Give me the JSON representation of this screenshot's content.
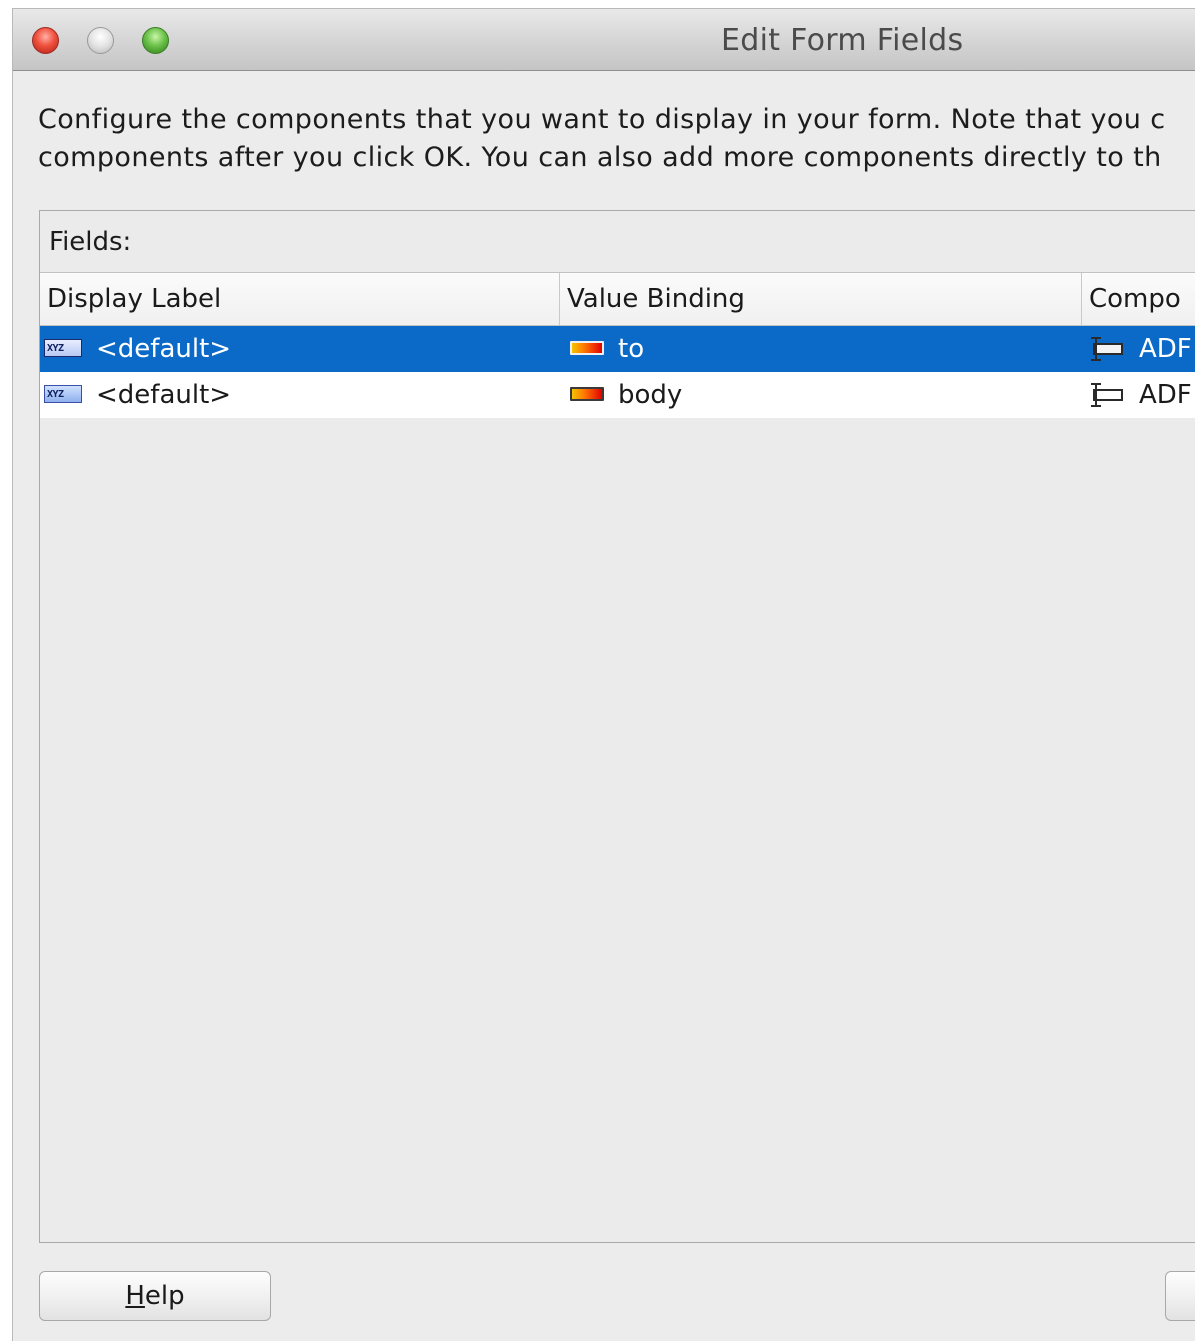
{
  "window": {
    "title": "Edit Form Fields"
  },
  "description": {
    "line1": "Configure the components that you want to display in your form.  Note that you c",
    "line2": "components after you click OK.  You can also add more components directly to th"
  },
  "fields_panel": {
    "label": "Fields:",
    "columns": [
      "Display Label",
      "Value Binding",
      "Compo"
    ],
    "rows": [
      {
        "display_label": "<default>",
        "display_icon": "xyz-text-icon",
        "value_binding": "to",
        "binding_icon": "binding-attribute-icon",
        "component": "ADF",
        "component_icon": "input-text-component-icon",
        "selected": true
      },
      {
        "display_label": "<default>",
        "display_icon": "xyz-text-icon",
        "value_binding": "body",
        "binding_icon": "binding-attribute-icon",
        "component": "ADF",
        "component_icon": "input-text-component-icon",
        "selected": false
      }
    ]
  },
  "buttons": {
    "help_prefix": "H",
    "help_rest": "elp"
  },
  "colors": {
    "selection": "#0b6ac8",
    "window_bg": "#ececec"
  }
}
